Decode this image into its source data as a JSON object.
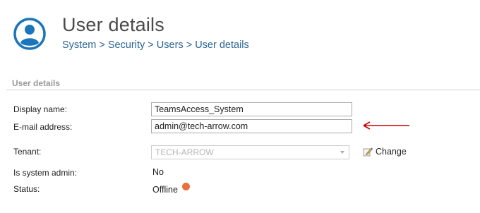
{
  "header": {
    "title": "User details",
    "icon": "user-icon",
    "icon_color": "#1b75bb"
  },
  "breadcrumb": {
    "items": [
      "System",
      "Security",
      "Users",
      "User details"
    ],
    "separator": ">"
  },
  "section": {
    "title": "User details"
  },
  "form": {
    "display_name_label": "Display name:",
    "display_name_value": "TeamsAccess_System",
    "email_label": "E-mail address:",
    "email_value": "admin@tech-arrow.com",
    "tenant_label": "Tenant:",
    "tenant_value": "TECH-ARROW",
    "change_label": "Change",
    "change_icon": "pencil-icon",
    "is_admin_label": "Is system admin:",
    "is_admin_value": "No",
    "status_label": "Status:",
    "status_value": "Offline",
    "status_color": "#e8703d"
  },
  "annotation": {
    "arrow_color": "#cc0000"
  }
}
